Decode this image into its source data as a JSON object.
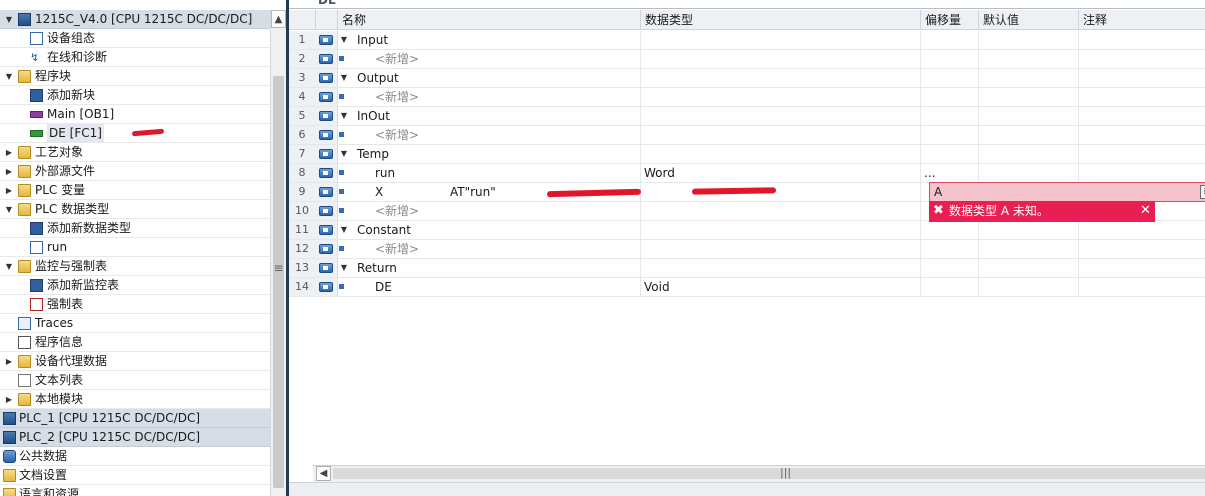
{
  "tree": {
    "items": [
      {
        "label": "1215C_V4.0 [CPU 1215C DC/DC/DC]",
        "toggle": "▼",
        "icon": "plc-icon",
        "kind": "plc"
      },
      {
        "label": "设备组态",
        "toggle": "",
        "icon": "device-config-icon",
        "kind": "cfg"
      },
      {
        "label": "在线和诊断",
        "toggle": "",
        "icon": "online-diagnostics-icon",
        "kind": "diag"
      },
      {
        "label": "程序块",
        "toggle": "▼",
        "icon": "folder-icon",
        "kind": "folder"
      },
      {
        "label": "添加新块",
        "toggle": "",
        "icon": "add-new-block-icon",
        "kind": "add"
      },
      {
        "label": "Main [OB1]",
        "toggle": "",
        "icon": "ob-block-icon",
        "kind": "ob"
      },
      {
        "label": "DE [FC1]",
        "toggle": "",
        "icon": "fc-block-icon",
        "kind": "fc"
      },
      {
        "label": "工艺对象",
        "toggle": "▶",
        "icon": "folder-icon",
        "kind": "folder"
      },
      {
        "label": "外部源文件",
        "toggle": "▶",
        "icon": "folder-icon",
        "kind": "folder"
      },
      {
        "label": "PLC 变量",
        "toggle": "▶",
        "icon": "folder-icon",
        "kind": "folder"
      },
      {
        "label": "PLC 数据类型",
        "toggle": "▼",
        "icon": "folder-icon",
        "kind": "folder"
      },
      {
        "label": "添加新数据类型",
        "toggle": "",
        "icon": "add-new-datatype-icon",
        "kind": "add"
      },
      {
        "label": "run",
        "toggle": "",
        "icon": "datatype-icon",
        "kind": "table"
      },
      {
        "label": "监控与强制表",
        "toggle": "▼",
        "icon": "folder-icon",
        "kind": "folder"
      },
      {
        "label": "添加新监控表",
        "toggle": "",
        "icon": "add-new-watch-table-icon",
        "kind": "add"
      },
      {
        "label": "强制表",
        "toggle": "",
        "icon": "force-table-icon",
        "kind": "force"
      },
      {
        "label": "Traces",
        "toggle": "",
        "icon": "traces-icon",
        "kind": "trace"
      },
      {
        "label": "程序信息",
        "toggle": "",
        "icon": "program-info-icon",
        "kind": "info"
      },
      {
        "label": "设备代理数据",
        "toggle": "▶",
        "icon": "folder-icon",
        "kind": "folder"
      },
      {
        "label": "文本列表",
        "toggle": "",
        "icon": "text-list-icon",
        "kind": "text"
      },
      {
        "label": "本地模块",
        "toggle": "▶",
        "icon": "folder-icon",
        "kind": "folder"
      },
      {
        "label": "PLC_1 [CPU 1215C DC/DC/DC]",
        "toggle": "",
        "icon": "plc-icon",
        "kind": "plc"
      },
      {
        "label": "PLC_2 [CPU 1215C DC/DC/DC]",
        "toggle": "",
        "icon": "plc-icon",
        "kind": "plc"
      },
      {
        "label": "公共数据",
        "toggle": "",
        "icon": "common-data-icon",
        "kind": "db"
      },
      {
        "label": "文档设置",
        "toggle": "",
        "icon": "document-settings-icon",
        "kind": "folder"
      },
      {
        "label": "语言和资源",
        "toggle": "",
        "icon": "languages-icon",
        "kind": "folder"
      }
    ]
  },
  "editor": {
    "block_title": "DE",
    "columns": [
      "名称",
      "数据类型",
      "偏移量",
      "默认值",
      "注释"
    ],
    "rows": [
      {
        "num": "1",
        "toggle": "▼",
        "name": "Input",
        "type": "",
        "attr": ""
      },
      {
        "num": "2",
        "toggle": "",
        "name": "<新增>",
        "type": "",
        "attr": ""
      },
      {
        "num": "3",
        "toggle": "▼",
        "name": "Output",
        "type": "",
        "attr": ""
      },
      {
        "num": "4",
        "toggle": "",
        "name": "<新增>",
        "type": "",
        "attr": ""
      },
      {
        "num": "5",
        "toggle": "▼",
        "name": "InOut",
        "type": "",
        "attr": ""
      },
      {
        "num": "6",
        "toggle": "",
        "name": "<新增>",
        "type": "",
        "attr": ""
      },
      {
        "num": "7",
        "toggle": "▼",
        "name": "Temp",
        "type": "",
        "attr": ""
      },
      {
        "num": "8",
        "toggle": "",
        "name": "run",
        "type": "Word",
        "attr": ""
      },
      {
        "num": "9",
        "toggle": "",
        "name": "X",
        "type": "A",
        "attr": "AT\"run\""
      },
      {
        "num": "10",
        "toggle": "",
        "name": "<新增>",
        "type": "",
        "attr": ""
      },
      {
        "num": "11",
        "toggle": "▼",
        "name": "Constant",
        "type": "",
        "attr": ""
      },
      {
        "num": "12",
        "toggle": "",
        "name": "<新增>",
        "type": "",
        "attr": ""
      },
      {
        "num": "13",
        "toggle": "▼",
        "name": "Return",
        "type": "",
        "attr": ""
      },
      {
        "num": "14",
        "toggle": "",
        "name": "DE",
        "type": "Void",
        "attr": ""
      }
    ],
    "offset_ellipsis": "...",
    "error_message": "数据类型 A 未知。",
    "error_close": "✕",
    "error_icon": "✖",
    "browse_icon": "≣"
  },
  "scroll": {
    "left": "◀",
    "up": "▲",
    "grip": "|||",
    "tree_grip": "≡"
  },
  "colors": {
    "error_bg": "#e91f53",
    "error_cell": "#f6c3cd",
    "splitter": "#27394f",
    "annotation_red": "#e0172a"
  }
}
